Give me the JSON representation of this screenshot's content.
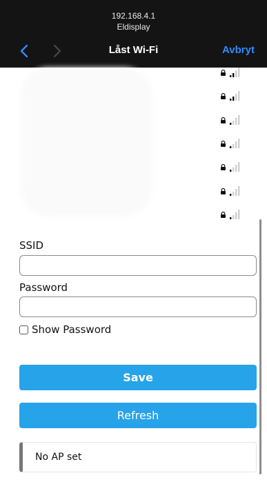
{
  "browser": {
    "url": "192.168.4.1",
    "page_name": "Eldisplay",
    "title": "Låst Wi-Fi",
    "cancel_label": "Avbryt",
    "back_icon": "chevron-left-icon",
    "forward_icon": "chevron-right-icon",
    "accent": "#2f8cff"
  },
  "networks": [
    {
      "locked": true,
      "signal": 2
    },
    {
      "locked": true,
      "signal": 2
    },
    {
      "locked": true,
      "signal": 1
    },
    {
      "locked": true,
      "signal": 1
    },
    {
      "locked": true,
      "signal": 1
    },
    {
      "locked": true,
      "signal": 1
    },
    {
      "locked": true,
      "signal": 1
    }
  ],
  "form": {
    "ssid_label": "SSID",
    "ssid_value": "",
    "password_label": "Password",
    "password_value": "",
    "show_password_label": "Show Password",
    "show_password_checked": false,
    "save_label": "Save",
    "refresh_label": "Refresh",
    "button_color": "#27a3ea"
  },
  "status": {
    "message": "No AP set"
  }
}
